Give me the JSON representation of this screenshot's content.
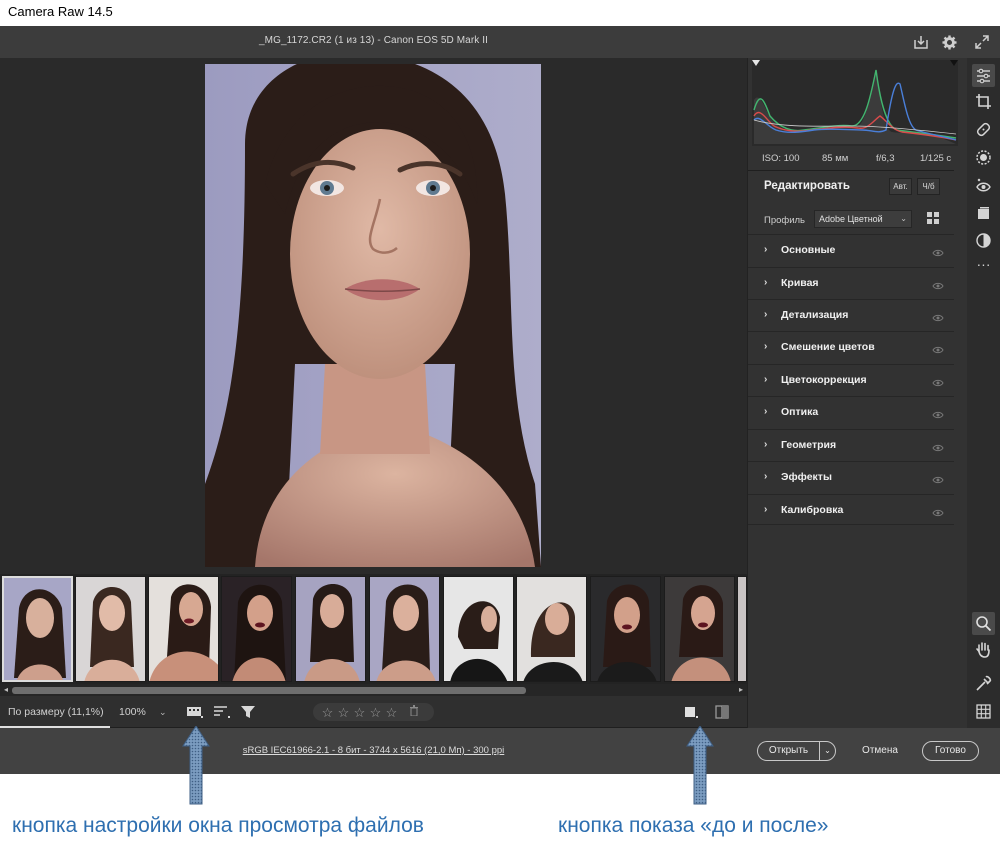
{
  "window": {
    "title": "Camera Raw 14.5"
  },
  "header": {
    "file_title": "_MG_1172.CR2  (1 из 13)  -  Canon EOS 5D Mark II"
  },
  "toolbar": {
    "zoom_fit_label": "По размеру (11,1%)",
    "zoom_100_label": "100%",
    "zoom_dropdown": "⌄",
    "stars": [
      "☆",
      "☆",
      "☆",
      "☆",
      "☆"
    ]
  },
  "camera_info": {
    "iso": "ISO: 100",
    "focal": "85 мм",
    "aperture": "f/6,3",
    "shutter": "1/125 с"
  },
  "edit": {
    "title": "Редактировать",
    "auto_label": "Авт.",
    "bw_label": "Ч/б",
    "profile_label": "Профиль",
    "profile_value": "Adobe Цветной"
  },
  "sections": [
    {
      "label": "Основные",
      "chevron": "›"
    },
    {
      "label": "Кривая",
      "chevron": "›"
    },
    {
      "label": "Детализация",
      "chevron": "›"
    },
    {
      "label": "Смешение цветов",
      "chevron": "›"
    },
    {
      "label": "Цветокоррекция",
      "chevron": "›"
    },
    {
      "label": "Оптика",
      "chevron": "›"
    },
    {
      "label": "Геометрия",
      "chevron": "›"
    },
    {
      "label": "Эффекты",
      "chevron": "›"
    },
    {
      "label": "Калибровка",
      "chevron": "›"
    }
  ],
  "footer": {
    "file_info": "sRGB IEC61966-2.1 - 8 бит - 3744 x 5616 (21,0 Мп) - 300 ppi",
    "open_label": "Открыть",
    "open_dropdown": "⌄",
    "cancel_label": "Отмена",
    "done_label": "Готово"
  },
  "annotations": {
    "left": "кнопка настройки окна просмотра файлов",
    "right": "кнопка  показа «до и после»"
  },
  "colors": {
    "app_bg": "#2a2a2a",
    "panel_bg": "#323232",
    "annotation_text": "#2e6fb0",
    "annotation_arrow": "#6c8fb3"
  },
  "icons": {
    "header": [
      "save-icon",
      "gear-icon",
      "fullscreen-icon"
    ],
    "strip_top": [
      "edit-sliders-icon",
      "crop-icon",
      "healing-icon",
      "mask-icon",
      "red-eye-icon",
      "snapshots-icon",
      "presets-icon",
      "more-icon"
    ],
    "strip_bottom": [
      "zoom-icon",
      "hand-icon",
      "eyedropper-icon",
      "grid-icon"
    ]
  }
}
